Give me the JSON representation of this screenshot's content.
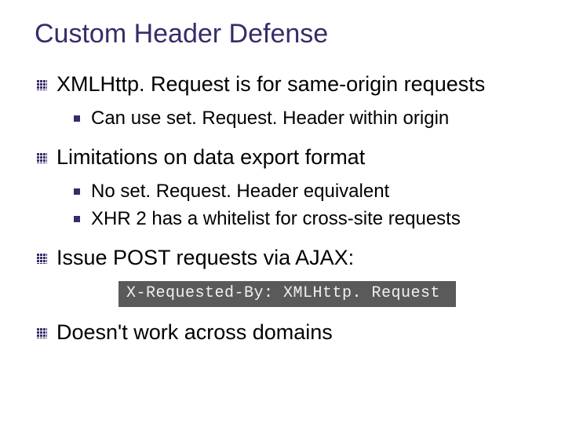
{
  "title": "Custom Header Defense",
  "bullets": {
    "b1": {
      "text": "XMLHttp. Request is for same-origin requests",
      "sub": {
        "s1": "Can use set. Request. Header within origin"
      }
    },
    "b2": {
      "text": "Limitations on data export format",
      "sub": {
        "s1": "No set. Request. Header equivalent",
        "s2": "XHR 2 has a whitelist for cross-site requests"
      }
    },
    "b3": {
      "text": "Issue POST requests via AJAX:"
    },
    "code": "X-Requested-By: XMLHttp. Request",
    "b4": {
      "text": "Doesn't work across domains"
    }
  }
}
